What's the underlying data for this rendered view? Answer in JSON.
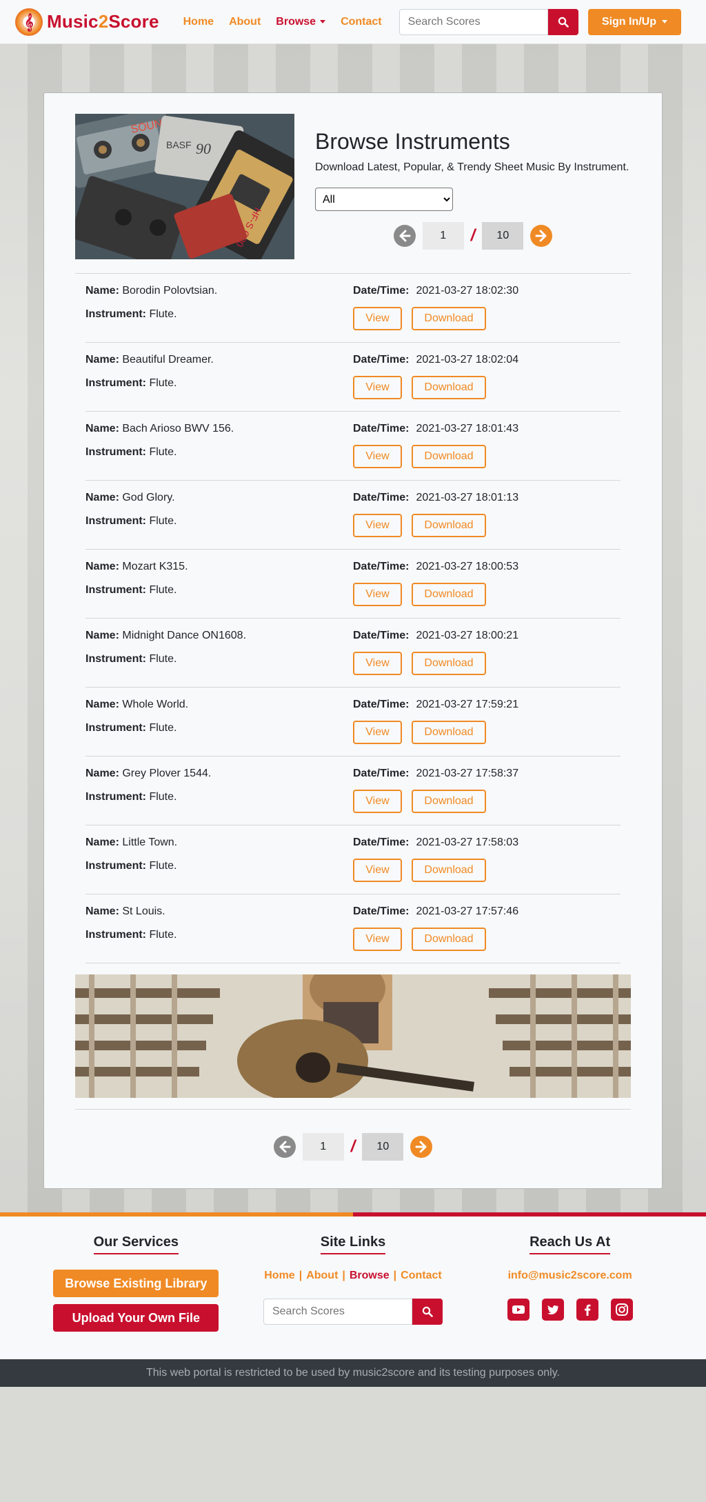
{
  "nav": {
    "brand_prefix": "Music",
    "brand_two": "2",
    "brand_suffix": "Score",
    "links": [
      {
        "label": "Home"
      },
      {
        "label": "About"
      },
      {
        "label": "Browse"
      },
      {
        "label": "Contact"
      }
    ],
    "search_placeholder": "Search Scores",
    "signin_label": "Sign In/Up"
  },
  "hero": {
    "title": "Browse Instruments",
    "subtitle": "Download Latest, Popular, & Trendy Sheet Music By Instrument.",
    "select_value": "All",
    "cassette_labels": [
      "SOUND",
      "BASF",
      "90",
      "HF-S C90"
    ]
  },
  "pager": {
    "current": "1",
    "separator": "/",
    "total": "10"
  },
  "labels": {
    "name": "Name:",
    "instrument": "Instrument:",
    "datetime": "Date/Time:",
    "view": "View",
    "download": "Download"
  },
  "scores": [
    {
      "name": "Borodin Polovtsian.",
      "instrument": "Flute.",
      "datetime": "2021-03-27 18:02:30"
    },
    {
      "name": "Beautiful Dreamer.",
      "instrument": "Flute.",
      "datetime": "2021-03-27 18:02:04"
    },
    {
      "name": "Bach Arioso BWV 156.",
      "instrument": "Flute.",
      "datetime": "2021-03-27 18:01:43"
    },
    {
      "name": "God Glory.",
      "instrument": "Flute.",
      "datetime": "2021-03-27 18:01:13"
    },
    {
      "name": "Mozart K315.",
      "instrument": "Flute.",
      "datetime": "2021-03-27 18:00:53"
    },
    {
      "name": "Midnight Dance ON1608.",
      "instrument": "Flute.",
      "datetime": "2021-03-27 18:00:21"
    },
    {
      "name": "Whole World.",
      "instrument": "Flute.",
      "datetime": "2021-03-27 17:59:21"
    },
    {
      "name": "Grey Plover 1544.",
      "instrument": "Flute.",
      "datetime": "2021-03-27 17:58:37"
    },
    {
      "name": "Little Town.",
      "instrument": "Flute.",
      "datetime": "2021-03-27 17:58:03"
    },
    {
      "name": "St Louis.",
      "instrument": "Flute.",
      "datetime": "2021-03-27 17:57:46"
    }
  ],
  "footer": {
    "services_title": "Our Services",
    "browse_library": "Browse Existing Library",
    "upload_file": "Upload Your Own File",
    "site_links_title": "Site Links",
    "links": [
      {
        "label": "Home"
      },
      {
        "label": "About"
      },
      {
        "label": "Browse"
      },
      {
        "label": "Contact"
      }
    ],
    "link_separator": "|",
    "search_placeholder": "Search Scores",
    "reach_title": "Reach Us At",
    "email": "info@music2score.com",
    "socials": [
      "youtube-icon",
      "twitter-icon",
      "facebook-icon",
      "instagram-icon"
    ],
    "copyright": "This web portal is restricted to be used by music2score and its testing purposes only."
  },
  "colors": {
    "brand_red": "#c8102e",
    "brand_orange": "#f08a24",
    "footer_dark": "#343a40"
  }
}
